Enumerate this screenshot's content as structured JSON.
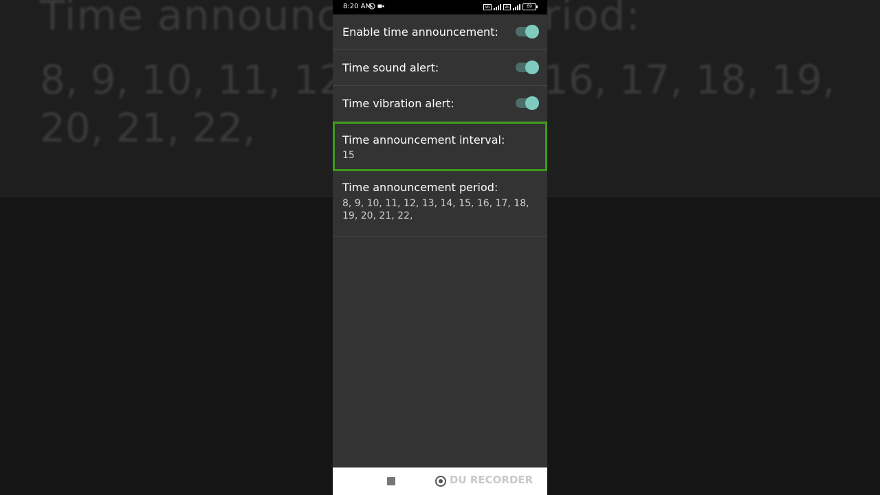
{
  "status_bar": {
    "time": "8:20 AM",
    "battery": "69"
  },
  "background": {
    "title": "Time announcement period:",
    "line1": "8, 9, 10, 11, 12,",
    "line1b": "16, 17, 18, 19,",
    "line2": "20, 21, 22,"
  },
  "settings": {
    "enable_label": "Enable time announcement:",
    "sound_label": "Time sound alert:",
    "vibration_label": "Time vibration alert:",
    "interval_label": "Time announcement interval:",
    "interval_value": "15",
    "period_label": "Time announcement period:",
    "period_value": "8, 9, 10, 11, 12, 13, 14, 15, 16, 17, 18, 19, 20, 21, 22,"
  },
  "watermark": "DU RECORDER",
  "colors": {
    "accent": "#7fcbc0",
    "highlight_border": "#3e9a1a",
    "panel": "#333333"
  }
}
